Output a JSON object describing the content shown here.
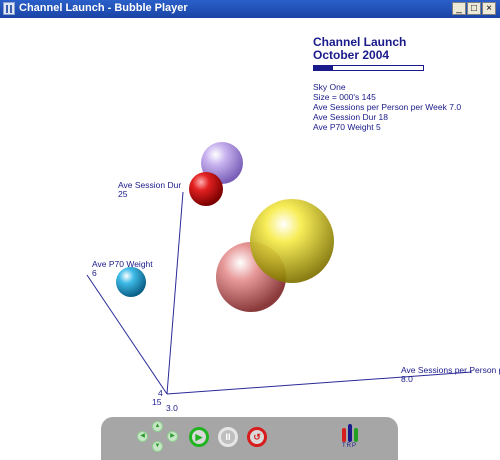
{
  "window": {
    "title": "Channel Launch - Bubble Player",
    "minimize_symbol": "_",
    "maximize_symbol": "□",
    "close_symbol": "×"
  },
  "info": {
    "title_line1": "Channel Launch",
    "title_line2": "October 2004",
    "progress": 0.17,
    "channel": "Sky One",
    "size": "Size = 000's 145",
    "sessions": "Ave Sessions per Person per Week 7.0",
    "session_dur": "Ave Session Dur 18",
    "p70_weight": "Ave P70 Weight 5"
  },
  "axes": {
    "y_name": "Ave Session Dur",
    "y_max": "25",
    "z_name": "Ave P70 Weight",
    "z_max": "6",
    "x_name": "Ave Sessions per Person p",
    "x_max": "8.0",
    "origin_z": "4",
    "origin_y": "15",
    "origin_x": "3.0"
  },
  "bubbles": [
    {
      "name": "purple-bubble",
      "color": "#b9a0e6"
    },
    {
      "name": "red-bubble",
      "color": "#e02020"
    },
    {
      "name": "yellow-bubble",
      "color": "#f2e21c"
    },
    {
      "name": "pink-bubble",
      "color": "#e48a8a"
    },
    {
      "name": "cyan-bubble",
      "color": "#2aaee0"
    }
  ],
  "controls": {
    "up_icon": "▲",
    "down_icon": "▼",
    "left_icon": "◀",
    "right_icon": "▶",
    "play_icon": "▶",
    "pause_icon": "II",
    "rewind_icon": "↺",
    "logo_text": "TRP"
  }
}
